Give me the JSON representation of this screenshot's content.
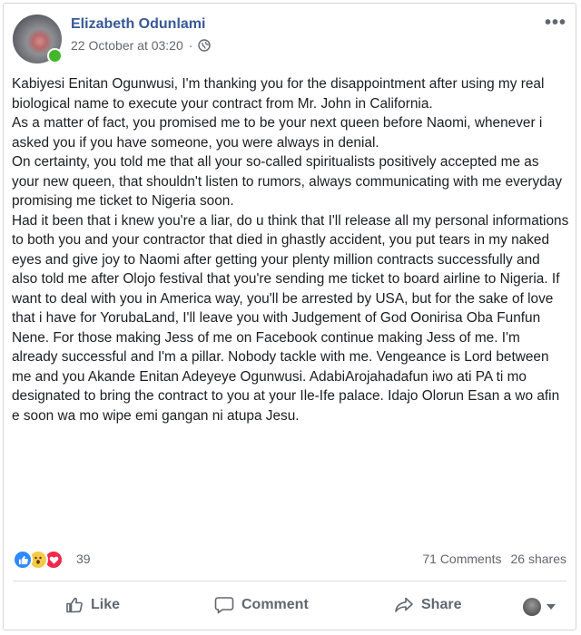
{
  "post": {
    "author": "Elizabeth Odunlami",
    "timestamp": "22 October at 03:20",
    "timestamp_separator": "·",
    "more_label": "•••",
    "paragraphs": [
      "Kabiyesi Enitan Ogunwusi, I'm thanking you for the disappointment after using my real biological name to execute your contract from Mr. John in California.",
      "As a matter of fact, you promised me to be your next queen before Naomi, whenever i asked you if you have someone, you were always in denial.",
      "On certainty, you told me that all your so-called spiritualists positively accepted me as your new queen, that shouldn't listen to rumors, always communicating with me everyday promising me ticket to Nigeria soon.",
      "Had it been that i knew you're a liar, do u think that I'll release all my personal informations to both you and your contractor that died in ghastly accident, you put tears in my naked eyes and give joy to Naomi after getting your plenty million contracts successfully and also told me after Olojo festival that you're sending me ticket to board airline to Nigeria. If want to deal with you in America way, you'll be arrested by USA, but for the sake of love that i have for YorubaLand, I'll leave you with Judgement of God Oonirisa Oba Funfun Nene. For those making Jess of me on Facebook continue making Jess of me. I'm already successful and I'm a pillar. Nobody tackle with me. Vengeance is Lord between me and you Akande Enitan Adeyeye Ogunwusi. AdabiArojahadafun iwo ati PA ti mo designated to bring the contract to you at your Ile-Ife palace. Idajo Olorun Esan a wo afin e soon wa mo wipe emi gangan ni atupa Jesu."
    ]
  },
  "reactions": {
    "icons": [
      "like-reaction",
      "wow-reaction",
      "love-reaction"
    ],
    "count": "39",
    "comments": "71 Comments",
    "shares": "26 shares"
  },
  "actions": {
    "like": "Like",
    "comment": "Comment",
    "share": "Share"
  },
  "colors": {
    "author": "#385898",
    "secondary_text": "#606770",
    "like_blue": "#2e89ff",
    "love_red": "#f0284a",
    "wow_yellow": "#f7c94b",
    "online_green": "#42b72a"
  }
}
